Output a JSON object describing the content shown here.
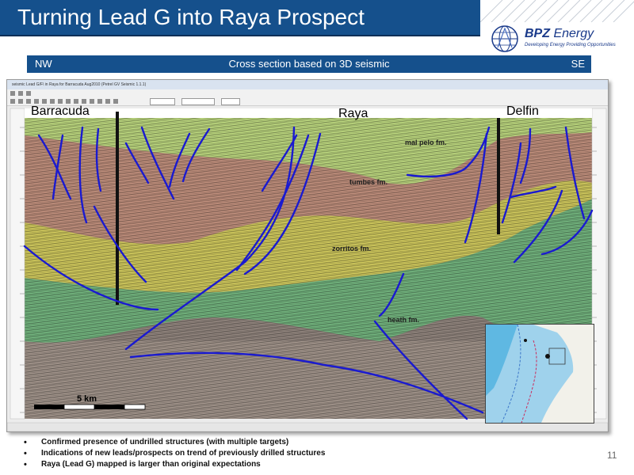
{
  "slide": {
    "title": "Turning Lead G into Raya Prospect",
    "page_number": "11"
  },
  "logo": {
    "name_bold": "BPZ",
    "name_rest": "Energy",
    "tagline": "Developing Energy   Providing Opportunities"
  },
  "section_header": {
    "left": "NW",
    "center": "Cross section based on 3D seismic",
    "right": "SE"
  },
  "seismic_window": {
    "title": "seismic Lead G/F\\ in Raya for Barracuda Aug2010 (Petrel GV Seismic 1.1.1)",
    "wells": {
      "barracuda": "Barracuda",
      "raya": "Raya",
      "delfin": "Delfin"
    },
    "formations": {
      "mal_pelo": "mal pelo fm.",
      "tumbes": "tumbes fm.",
      "zorritos": "zorritos fm.",
      "heath": "heath fm."
    },
    "scale_bar": "5 km",
    "colors": {
      "mal_pelo": "#b5cf7a",
      "tumbes": "#b98a78",
      "zorritos": "#c9c25a",
      "heath": "#6fae7a",
      "basement": "#9c8f86",
      "fault": "#1a1ad0"
    }
  },
  "bullets": [
    "Confirmed presence of undrilled structures (with multiple targets)",
    "Indications of new leads/prospects on trend of previously drilled structures",
    "Raya (Lead G) mapped is larger than original expectations"
  ]
}
